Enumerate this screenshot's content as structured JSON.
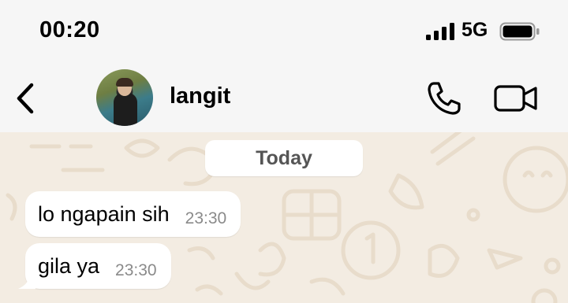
{
  "status_bar": {
    "time": "00:20",
    "network": "5G",
    "icons": [
      "signal-icon",
      "battery-icon"
    ]
  },
  "header": {
    "back_icon": "chevron-left-icon",
    "contact_name": "langit",
    "call_icon": "phone-icon",
    "video_icon": "video-camera-icon"
  },
  "chat": {
    "date_separator": "Today",
    "messages": [
      {
        "text": "lo ngapain sih",
        "time": "23:30"
      },
      {
        "text": "gila ya",
        "time": "23:30"
      }
    ]
  },
  "colors": {
    "bar_background": "#f6f6f6",
    "chat_background": "#f3ece2",
    "bubble": "#ffffff",
    "timestamp": "#8a8a8a"
  }
}
